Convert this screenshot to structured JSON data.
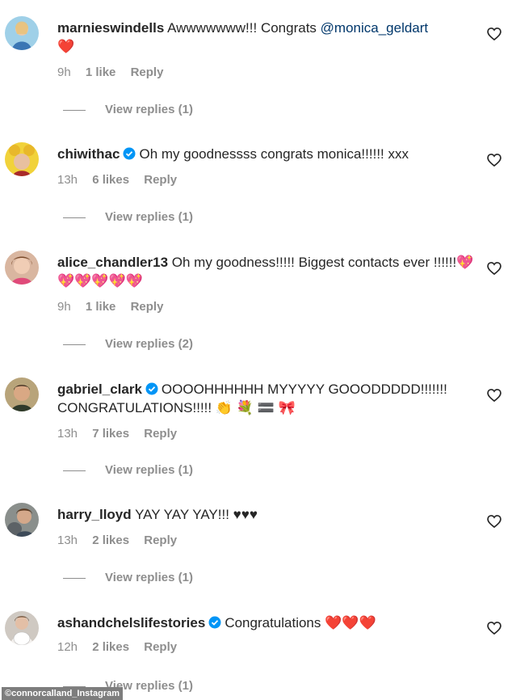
{
  "comments": [
    {
      "username": "marnieswindells",
      "verified": false,
      "text": "Awwwwwww!!! Congrats ",
      "mention": "@monica_geldart",
      "emoji": "❤️",
      "time": "9h",
      "likes": "1 like",
      "reply": "Reply",
      "view_replies": "View replies (1)"
    },
    {
      "username": "chiwithac",
      "verified": true,
      "text": "Oh my goodnessss congrats monica!!!!!! xxx",
      "time": "13h",
      "likes": "6 likes",
      "reply": "Reply",
      "view_replies": "View replies (1)"
    },
    {
      "username": "alice_chandler13",
      "verified": false,
      "text": "Oh my goodness!!!!! Biggest contacts ever !!!!!!",
      "emoji": "💖💖💖💖💖💖",
      "time": "9h",
      "likes": "1 like",
      "reply": "Reply",
      "view_replies": "View replies (2)"
    },
    {
      "username": "gabriel_clark",
      "verified": true,
      "text": "OOOOHHHHHH MYYYYY GOOODDDDD!!!!!!! CONGRATULATIONS!!!!!",
      "emoji": "👏 💐 🟰 🎀",
      "time": "13h",
      "likes": "7 likes",
      "reply": "Reply",
      "view_replies": "View replies (1)"
    },
    {
      "username": "harry_lloyd",
      "verified": false,
      "text": "YAY YAY YAY!!! ♥♥♥",
      "time": "13h",
      "likes": "2 likes",
      "reply": "Reply",
      "view_replies": "View replies (1)"
    },
    {
      "username": "ashandchelslifestories",
      "verified": true,
      "text": "Congratulations",
      "emoji": "❤️❤️❤️",
      "time": "12h",
      "likes": "2 likes",
      "reply": "Reply",
      "view_replies": "View replies (1)"
    }
  ],
  "watermark": "©connorcalland_Instagram",
  "icons": {
    "like": "heart-outline-icon",
    "verified": "verified-badge-icon"
  },
  "colors": {
    "username": "#262626",
    "meta": "#8e8e8e",
    "mention": "#00376b",
    "verified": "#0095f6"
  }
}
